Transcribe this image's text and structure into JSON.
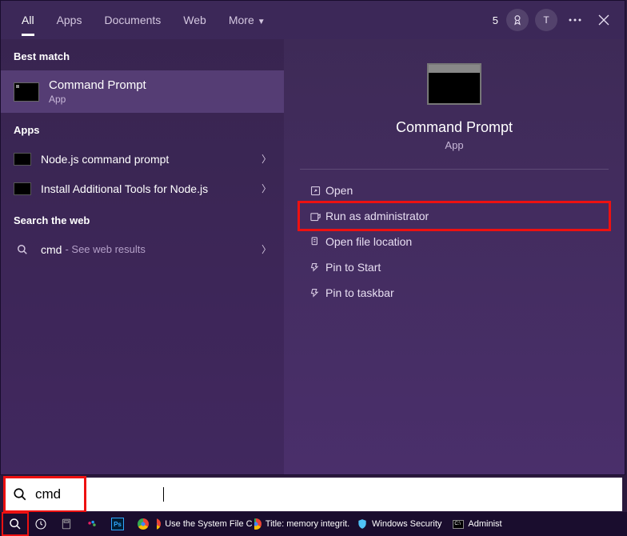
{
  "tabs": {
    "all": "All",
    "apps": "Apps",
    "documents": "Documents",
    "web": "Web",
    "more": "More"
  },
  "top_right": {
    "points": "5",
    "avatar": "T"
  },
  "sections": {
    "best_match": "Best match",
    "apps": "Apps",
    "search_web": "Search the web"
  },
  "best_match": {
    "title": "Command Prompt",
    "sub": "App"
  },
  "apps_list": [
    {
      "label": "Node.js command prompt"
    },
    {
      "label": "Install Additional Tools for Node.js"
    }
  ],
  "web": {
    "query": "cmd",
    "hint": "- See web results"
  },
  "preview": {
    "title": "Command Prompt",
    "sub": "App"
  },
  "actions": [
    {
      "icon": "open",
      "label": "Open",
      "highlight": false
    },
    {
      "icon": "admin",
      "label": "Run as administrator",
      "highlight": true
    },
    {
      "icon": "folder",
      "label": "Open file location",
      "highlight": false
    },
    {
      "icon": "pin-start",
      "label": "Pin to Start",
      "highlight": false
    },
    {
      "icon": "pin-taskbar",
      "label": "Pin to taskbar",
      "highlight": false
    }
  ],
  "search_input": {
    "value": "cmd"
  },
  "taskbar": [
    {
      "type": "chrome",
      "label": "Use the System File C..."
    },
    {
      "type": "chrome",
      "label": "Title: memory integrit..."
    },
    {
      "type": "shield",
      "label": "Windows Security"
    },
    {
      "type": "cmd",
      "label": "Administ"
    }
  ]
}
